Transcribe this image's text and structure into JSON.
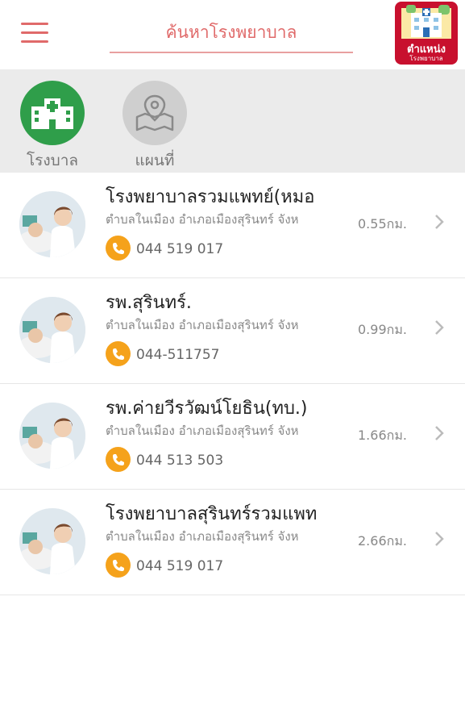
{
  "header": {
    "search_placeholder": "ค้นหาโรงพยาบาล",
    "logo_line1": "ตำแหน่ง",
    "logo_line2": "โรงพยาบาล"
  },
  "tabs": [
    {
      "label": "โรงบาล",
      "icon": "hospital-icon",
      "active": true
    },
    {
      "label": "แผนที่",
      "icon": "map-icon",
      "active": false
    }
  ],
  "hospitals": [
    {
      "name": "โรงพยาบาลรวมแพทย์(หมอ",
      "address": "ตำบลในเมือง อำเภอเมืองสุรินทร์ จังห",
      "distance": "0.55กม.",
      "phone": "044 519 017"
    },
    {
      "name": "รพ.สุรินทร์.",
      "address": "ตำบลในเมือง อำเภอเมืองสุรินทร์ จังห",
      "distance": "0.99กม.",
      "phone": "044-511757"
    },
    {
      "name": "รพ.ค่ายวีรวัฒน์โยธิน(ทบ.)",
      "address": "ตำบลในเมือง อำเภอเมืองสุรินทร์ จังห",
      "distance": "1.66กม.",
      "phone": "044 513 503"
    },
    {
      "name": "โรงพยาบาลสุรินทร์รวมแพท",
      "address": "ตำบลในเมือง อำเภอเมืองสุรินทร์ จังห",
      "distance": "2.66กม.",
      "phone": "044 519 017"
    }
  ],
  "colors": {
    "accent": "#e06a6a",
    "hospital_tab": "#2f9e4a",
    "phone_icon": "#f5a21b",
    "logo_bg": "#c8102e"
  }
}
